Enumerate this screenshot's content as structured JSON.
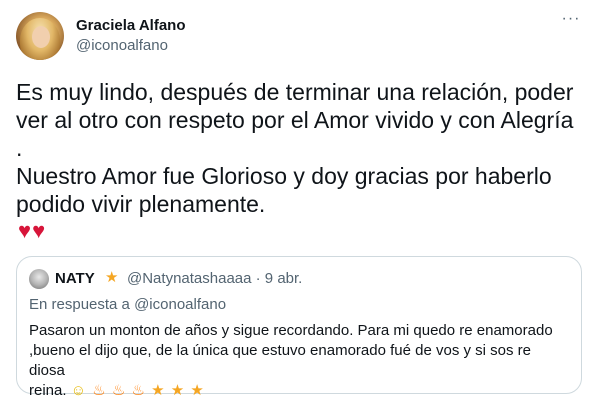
{
  "tweet": {
    "author_name": "Graciela Alfano",
    "author_handle": "@iconoalfano",
    "more_icon": "more-horizontal-icon",
    "text_lines": [
      "Es muy lindo, después de terminar una relación, poder",
      "ver al otro con respeto por el Amor vivido y con Alegría",
      ".",
      "Nuestro Amor fue Glorioso y doy gracias por haberlo",
      "podido vivir plenamente."
    ],
    "hearts": "♥♥",
    "heart_color": "#d7153a"
  },
  "quote": {
    "author_name": "NATY",
    "name_emoji": "★",
    "author_handle": "@Natynatashaaaa · 9 abr.",
    "reply_prefix": "En respuesta a",
    "reply_mention": "@iconoalfano",
    "text_lines": [
      "Pasaron un monton de años y sigue recordando. Para mi quedo re enamorado",
      ",bueno el dijo que, de la única que estuvo enamorado fué de vos y si sos re diosa",
      "reina."
    ],
    "emojis": [
      {
        "icon": "baby-angel-emoji",
        "glyph": "☺"
      },
      {
        "icon": "fire-emoji",
        "glyph": "♨"
      },
      {
        "icon": "fire-emoji",
        "glyph": "♨"
      },
      {
        "icon": "fire-emoji",
        "glyph": "♨"
      },
      {
        "icon": "star-emoji",
        "glyph": "★"
      },
      {
        "icon": "star-emoji",
        "glyph": "★"
      },
      {
        "icon": "star-emoji",
        "glyph": "★"
      }
    ]
  },
  "colors": {
    "text": "#0f1419",
    "secondary": "#536471",
    "border": "#cfd9de"
  }
}
